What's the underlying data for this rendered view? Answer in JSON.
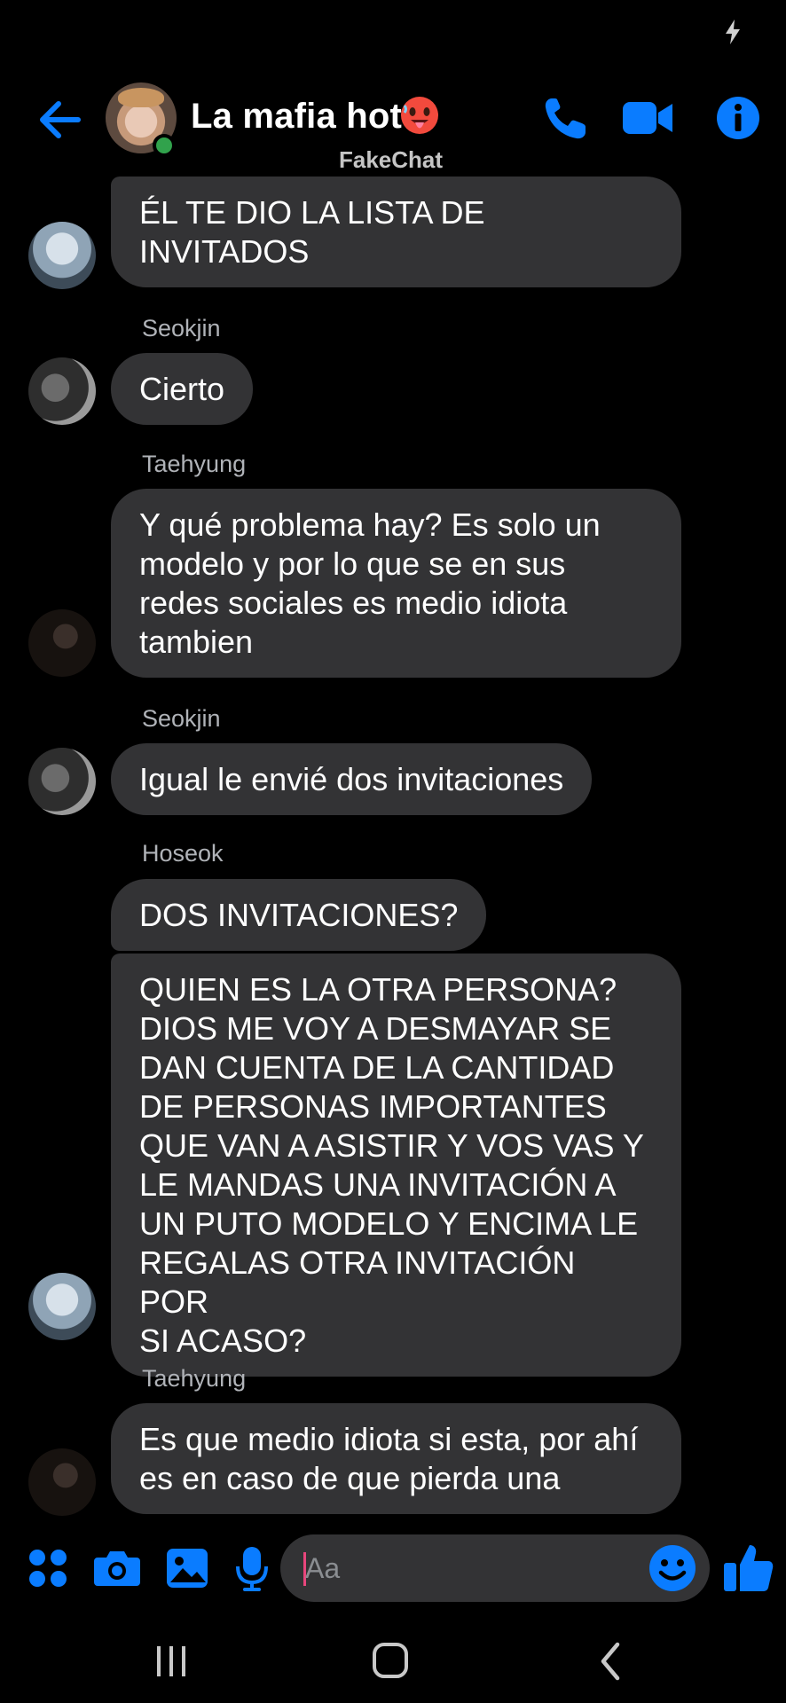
{
  "header": {
    "title": "La mafia hot",
    "watermark": "FakeChat",
    "title_emoji": "hot-face-emoji",
    "online": true
  },
  "icons": {
    "back": "arrow-left-icon",
    "call": "phone-icon",
    "video": "video-camera-icon",
    "info": "info-icon"
  },
  "colors": {
    "accent": "#0a7cff",
    "bubble": "#333335",
    "background": "#000000",
    "sender_name": "#b0b3b8",
    "online_dot": "#31a24c",
    "caret": "#e8467c"
  },
  "messages": [
    {
      "sender": "",
      "text": "ÉL TE DIO LA LISTA DE\nINVITADOS"
    },
    {
      "sender": "Seokjin",
      "text": "Cierto"
    },
    {
      "sender": "Taehyung",
      "text": "Y qué problema hay? Es solo un\nmodelo y por lo que se en sus\nredes sociales es medio idiota\ntambien"
    },
    {
      "sender": "Seokjin",
      "text": "Igual le envié dos invitaciones"
    },
    {
      "sender": "Hoseok",
      "text": "DOS INVITACIONES?"
    },
    {
      "sender": "",
      "text": "QUIEN ES LA OTRA PERSONA?\nDIOS ME VOY A DESMAYAR SE\nDAN CUENTA DE LA CANTIDAD\nDE PERSONAS IMPORTANTES\nQUE VAN A ASISTIR Y VOS VAS Y\nLE MANDAS UNA INVITACIÓN A\nUN PUTO MODELO Y ENCIMA LE\nREGALAS OTRA INVITACIÓN POR\nSI ACASO?"
    },
    {
      "sender": "Taehyung",
      "text": "Es que medio idiota si esta, por ahí\nes en caso de que pierda una"
    }
  ],
  "composer": {
    "placeholder": "Aa",
    "icons": [
      "apps-icon",
      "camera-icon",
      "gallery-icon",
      "mic-icon",
      "emoji-icon",
      "thumbs-up-icon"
    ]
  },
  "nav": {
    "icons": [
      "recents-icon",
      "home-icon",
      "back-icon"
    ]
  }
}
